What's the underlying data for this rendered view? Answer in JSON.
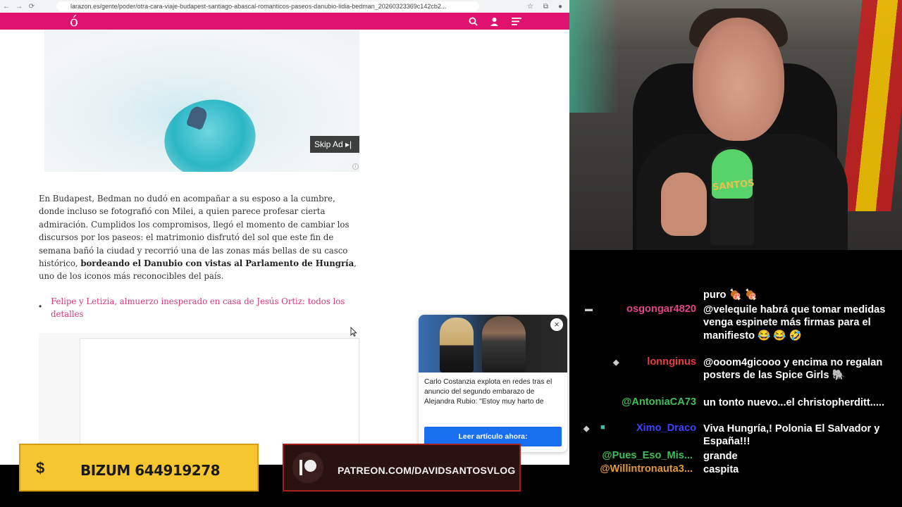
{
  "browser": {
    "url": "larazon.es/gente/poder/otra-cara-viaje-budapest-santiago-abascal-romanticos-paseos-danubio-lidia-bedman_20260323369c142cb2...",
    "video": {
      "skip_ad_label": "Skip Ad ▸|"
    }
  },
  "article": {
    "paragraph_start": "En Budapest, Bedman no dudó en acompañar a su esposo a la cumbre, donde incluso se fotografió con Milei, a quien parece profesar cierta admiración. Cumplidos los compromisos, llegó el momento de cambiar los discursos por los paseos: el matrimonio disfrutó del sol que este fin de semana bañó la ciudad y recorrió una de las zonas más bellas de su casco histórico, ",
    "paragraph_bold": "bordeando el Danubio con vistas al Parlamento de Hungría",
    "paragraph_end": ", uno de los iconos más reconocibles del país.",
    "related_link": "Felipe y Letizia, almuerzo inesperado en casa de Jesús Ortiz: todos los detalles"
  },
  "popup": {
    "headline": "Carlo Costanzia explota en redes tras el anuncio del segundo embarazo de Alejandra Rubio: \"Estoy muy harto de",
    "cta_label": "Leer artículo ahora:",
    "close_symbol": "×"
  },
  "webcam": {
    "mic_label": "SANTOS"
  },
  "chat": {
    "messages": [
      {
        "user": "",
        "text": "puro 🍖 🍖",
        "color": "#3a5cff"
      },
      {
        "user": "osgongar4820",
        "text": "@velequile habrá que tomar medidas venga espinete más firmas para el manifiesto 😂 😂 🤣",
        "color": "#e0458c"
      },
      {
        "user": "lonnginus",
        "text": "@ooom4gicooo y encima no regalan posters de las Spice Girls 🐘",
        "color": "#e53c3c"
      },
      {
        "user": "@AntoniaCA73",
        "text": "un tonto nuevo...el christopherditt.....",
        "color": "#3fbf5a"
      },
      {
        "user": "Ximo_Draco",
        "text": "Viva Hungría,! Polonia El Salvador y España!!!",
        "color": "#3a44ff"
      },
      {
        "user": "@Pues_Eso_Mis...",
        "text": "grande",
        "color": "#3fbf5a"
      },
      {
        "user": "@Willintronauta3...",
        "text": "caspita",
        "color": "#e39a3c"
      }
    ]
  },
  "banners": {
    "bizum": "BIZUM 644919278",
    "bizum_icon": "$",
    "patreon": "PATREON.COM/DAVIDSANTOSVLOG"
  }
}
